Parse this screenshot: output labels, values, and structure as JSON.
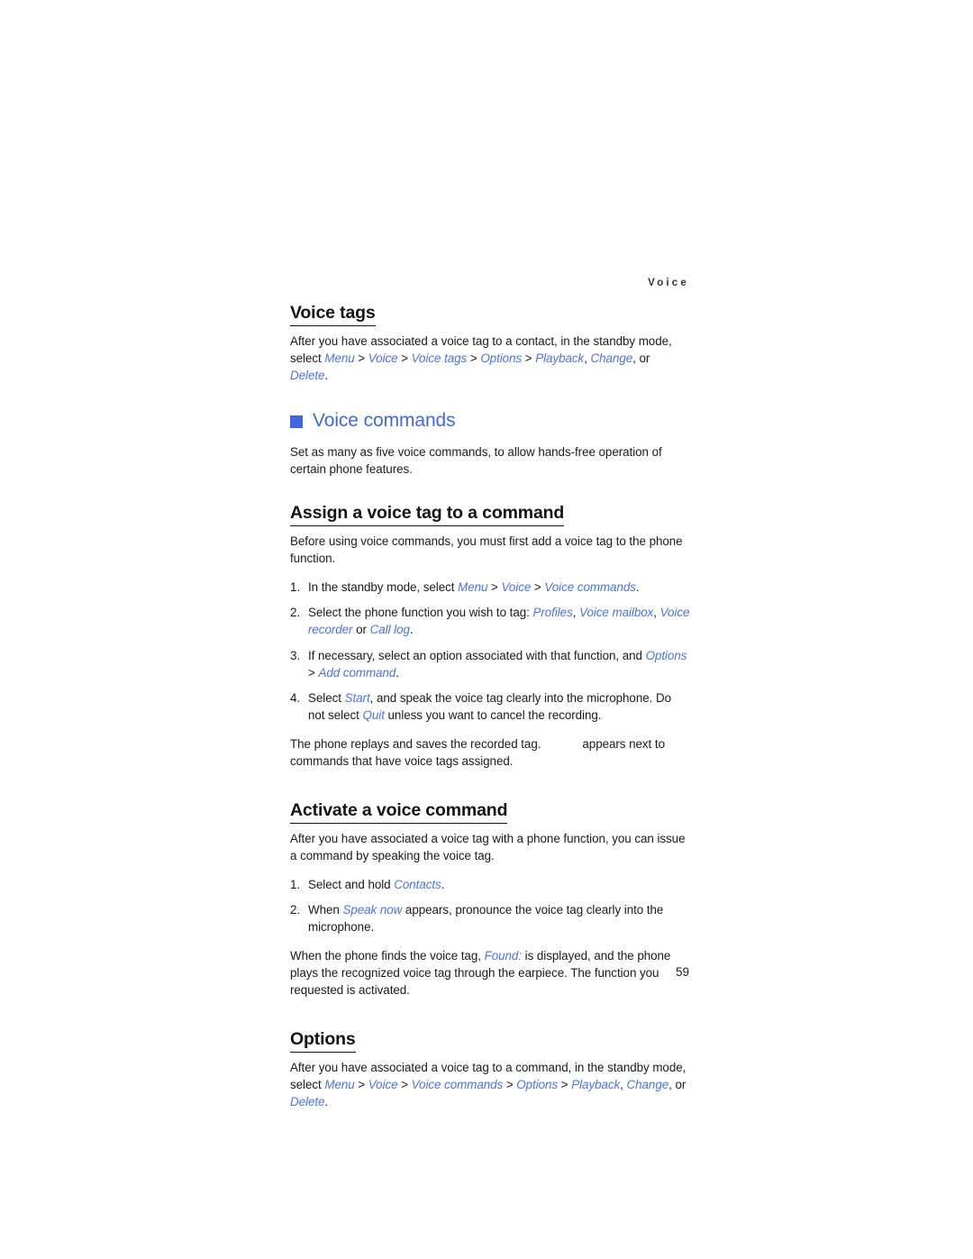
{
  "page": {
    "running_header": "Voice",
    "page_number": "59",
    "accent_color": "#3f68e0",
    "link_color": "#4a72e8",
    "text_color": "#1a1a1a",
    "background_color": "#ffffff"
  },
  "voice_tags": {
    "heading": "Voice tags",
    "paragraph_line1": "After you have associated a voice tag to a contact, in the standby mode, select",
    "path": {
      "menu": "Menu",
      "voice": "Voice",
      "voice_tags": "Voice tags",
      "options": "Options",
      "playback": "Playback",
      "change": "Change",
      "delete": "Delete",
      "sep": " > ",
      "comma": ", ",
      "or": ", or ",
      "period": "."
    }
  },
  "voice_commands": {
    "heading": "Voice commands",
    "bullet_icon": "square-bullet-icon",
    "intro": "Set as many as five voice commands, to allow hands-free operation of certain phone features."
  },
  "assign": {
    "heading": "Assign a voice tag to a command",
    "intro": "Before using voice commands, you must first add a voice tag to the phone function.",
    "steps": [
      {
        "num": "1.",
        "pre": "In the standby mode, select ",
        "ui1": "Menu",
        "sep1": " > ",
        "ui2": "Voice",
        "sep2": " > ",
        "ui3": "Voice commands",
        "post": "."
      },
      {
        "num": "2.",
        "pre": "Select the phone function you wish to tag: ",
        "ui1": "Profiles",
        "sep1": ", ",
        "ui2": "Voice mailbox",
        "sep2": ", ",
        "ui3": "Voice recorder",
        "sep3": " or ",
        "ui4": "Call log",
        "post": "."
      },
      {
        "num": "3.",
        "pre": "If necessary, select an option associated with that function, and ",
        "ui1": "Options",
        "sep1": " > ",
        "ui2": "Add command",
        "post": "."
      },
      {
        "num": "4.",
        "pre": "Select ",
        "ui1": "Start",
        "mid": ", and speak the voice tag clearly into the microphone. Do not select ",
        "ui2": "Quit",
        "post": " unless you want to cancel the recording."
      }
    ],
    "outro_before_icon": "The phone replays and saves the recorded tag.",
    "outro_icon": "voice-tag-indicator-icon",
    "outro_after_icon": "appears next to commands that have voice tags assigned."
  },
  "activate": {
    "heading": "Activate a voice command",
    "intro": "After you have associated a voice tag with a phone function, you can issue a command by speaking the voice tag.",
    "steps": [
      {
        "num": "1.",
        "pre": "Select and hold ",
        "ui1": "Contacts",
        "post": "."
      },
      {
        "num": "2.",
        "pre": "When ",
        "ui1": "Speak now",
        "post": " appears, pronounce the voice tag clearly into the microphone."
      }
    ],
    "outro_pre": "When the phone finds the voice tag, ",
    "outro_ui": "Found:",
    "outro_post": " is displayed, and the phone plays the recognized voice tag through the earpiece. The function you requested is activated."
  },
  "options": {
    "heading": "Options",
    "paragraph_line1": "After you have associated a voice tag to a command, in the standby mode, select",
    "path": {
      "menu": "Menu",
      "voice": "Voice",
      "voice_commands": "Voice commands",
      "options": "Options",
      "playback": "Playback",
      "change": "Change",
      "delete": "Delete",
      "sep": " > ",
      "comma": ", ",
      "or": ", or ",
      "period": "."
    }
  }
}
